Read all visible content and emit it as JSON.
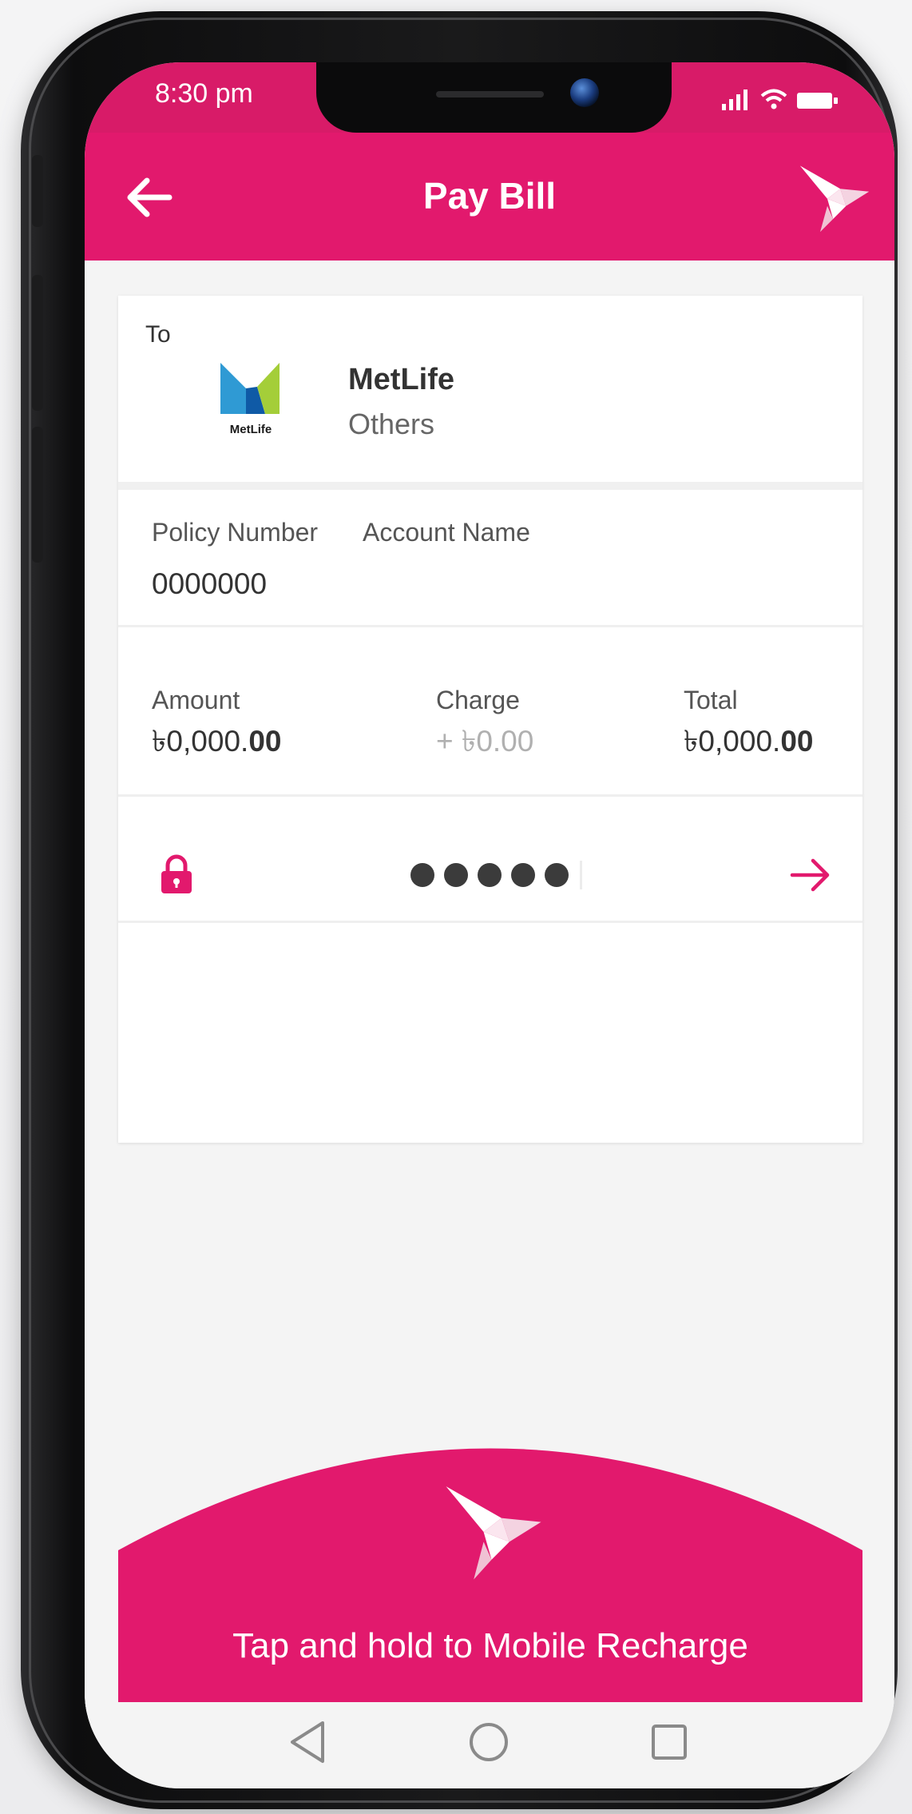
{
  "status_bar": {
    "time": "8:30 pm"
  },
  "app_bar": {
    "title": "Pay Bill"
  },
  "recipient": {
    "to_label": "To",
    "name": "MetLife",
    "category": "Others",
    "logo_text": "MetLife"
  },
  "fields": {
    "policy_number_label": "Policy Number",
    "account_name_label": "Account Name",
    "policy_number_value": "0000000"
  },
  "amounts": {
    "amount_label": "Amount",
    "amount_value_main": "৳0,000.",
    "amount_value_dec": "00",
    "charge_label": "Charge",
    "charge_value": "+ ৳0.00",
    "total_label": "Total",
    "total_value_main": "৳0,000.",
    "total_value_dec": "00"
  },
  "pin": {
    "dots_filled": 5
  },
  "action": {
    "label": "Tap and hold to Mobile Recharge"
  },
  "colors": {
    "brand": "#e2196d",
    "status_bar": "#d81b68",
    "text": "#333333",
    "muted": "#b0b0b0"
  },
  "icons": {
    "back": "arrow-left-icon",
    "brand": "bkash-bird-icon",
    "lock": "lock-icon",
    "submit": "arrow-right-icon",
    "nav_back": "triangle-back-icon",
    "nav_home": "circle-home-icon",
    "nav_recent": "square-recent-icon"
  }
}
